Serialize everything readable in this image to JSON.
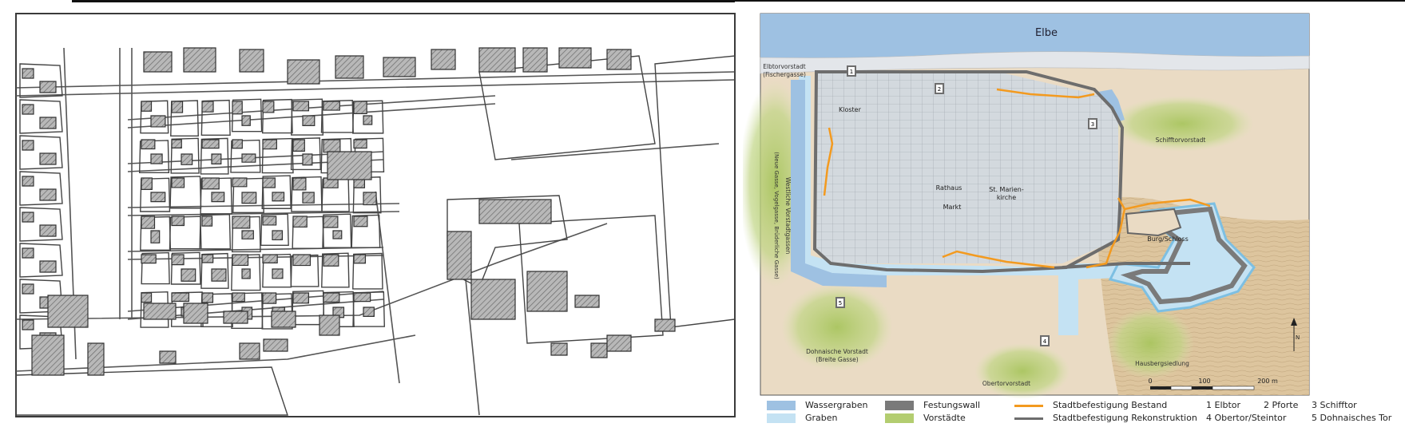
{
  "right_map": {
    "river_label": "Elbe",
    "suburbs": [
      {
        "id": "elbtor",
        "line1": "Elbtorvorstadt",
        "line2": "(Fischergasse)"
      },
      {
        "id": "schifftor",
        "line1": "Schifftorvorstadt",
        "line2": ""
      },
      {
        "id": "dohna",
        "line1": "Dohnaische Vorstadt",
        "line2": "(Breite Gasse)"
      },
      {
        "id": "obertor",
        "line1": "Obertorvorstadt",
        "line2": ""
      },
      {
        "id": "hausberg",
        "line1": "Hausbergsiedlung",
        "line2": ""
      },
      {
        "id": "west",
        "line1": "Westliche Vorstadtgassen",
        "line2": "(Neue Gasse, Vogelgasse, Brüderliche Gasse)"
      }
    ],
    "places": {
      "kloster": "Kloster",
      "rathaus": "Rathaus",
      "markt": "Markt",
      "kirche_l1": "St. Marien-",
      "kirche_l2": "kirche",
      "burg": "Burg/Schloss"
    },
    "gate_numbers": [
      "1",
      "2",
      "3",
      "4",
      "5"
    ],
    "north_label": "N",
    "scale": {
      "t0": "0",
      "t1": "100",
      "t2": "200 m"
    }
  },
  "legend": {
    "wassergraben": "Wassergraben",
    "graben": "Graben",
    "festungswall": "Festungswall",
    "vorstaedte": "Vorstädte",
    "bestand": "Stadtbefestigung Bestand",
    "rekonstruktion": "Stadtbefestigung Rekonstruktion",
    "gates": [
      "1 Elbtor",
      "2 Pforte",
      "3 Schifftor",
      "4 Obertor/Steintor",
      "5 Dohnaisches Tor"
    ]
  },
  "colors": {
    "water": "#9ec1e2",
    "moat_light": "#c4e2f3",
    "wall": "#7a7a7a",
    "suburb_green": "#b3cd70",
    "bestand_orange": "#f39a1f",
    "rekonstruktion_gray": "#6d6d6d",
    "ground": "#eadbc4",
    "block_fill": "#cfd5dc"
  }
}
